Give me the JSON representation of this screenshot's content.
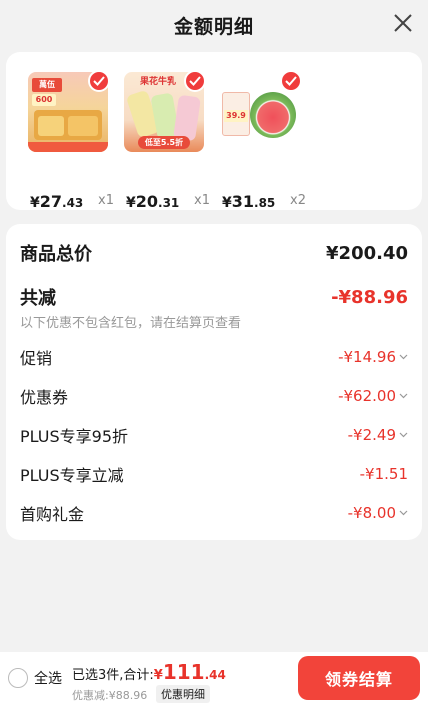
{
  "header": {
    "title": "金额明细"
  },
  "products": [
    {
      "currency": "¥",
      "price_int": "27",
      "price_dec": ".43",
      "qty": "x1",
      "image_text": [
        "萬伍",
        "600"
      ]
    },
    {
      "currency": "¥",
      "price_int": "20",
      "price_dec": ".31",
      "qty": "x1",
      "image_text": [
        "果花牛乳",
        "低至5.5折"
      ]
    },
    {
      "currency": "¥",
      "price_int": "31",
      "price_dec": ".85",
      "qty": "x2",
      "image_text": [
        "39.9"
      ]
    }
  ],
  "detail": {
    "total_label": "商品总价",
    "total_value": "¥200.40",
    "discount_label": "共减",
    "discount_value": "-¥88.96",
    "note": "以下优惠不包含红包，请在结算页查看",
    "items": [
      {
        "label": "促销",
        "value": "-¥14.96",
        "expandable": true
      },
      {
        "label": "优惠券",
        "value": "-¥62.00",
        "expandable": true
      },
      {
        "label": "PLUS专享95折",
        "value": "-¥2.49",
        "expandable": true
      },
      {
        "label": "PLUS专享立减",
        "value": "-¥1.51",
        "expandable": false
      },
      {
        "label": "首购礼金",
        "value": "-¥8.00",
        "expandable": true
      }
    ]
  },
  "footer": {
    "select_all": "全选",
    "summary_prefix": "已选3件,合计:",
    "currency": "¥",
    "amount_int": "111",
    "amount_dec": ".44",
    "saved": "优惠减:¥88.96",
    "detail_tag": "优惠明细",
    "checkout": "领券结算"
  },
  "colors": {
    "accent": "#e8332b",
    "button": "#f2443a"
  }
}
